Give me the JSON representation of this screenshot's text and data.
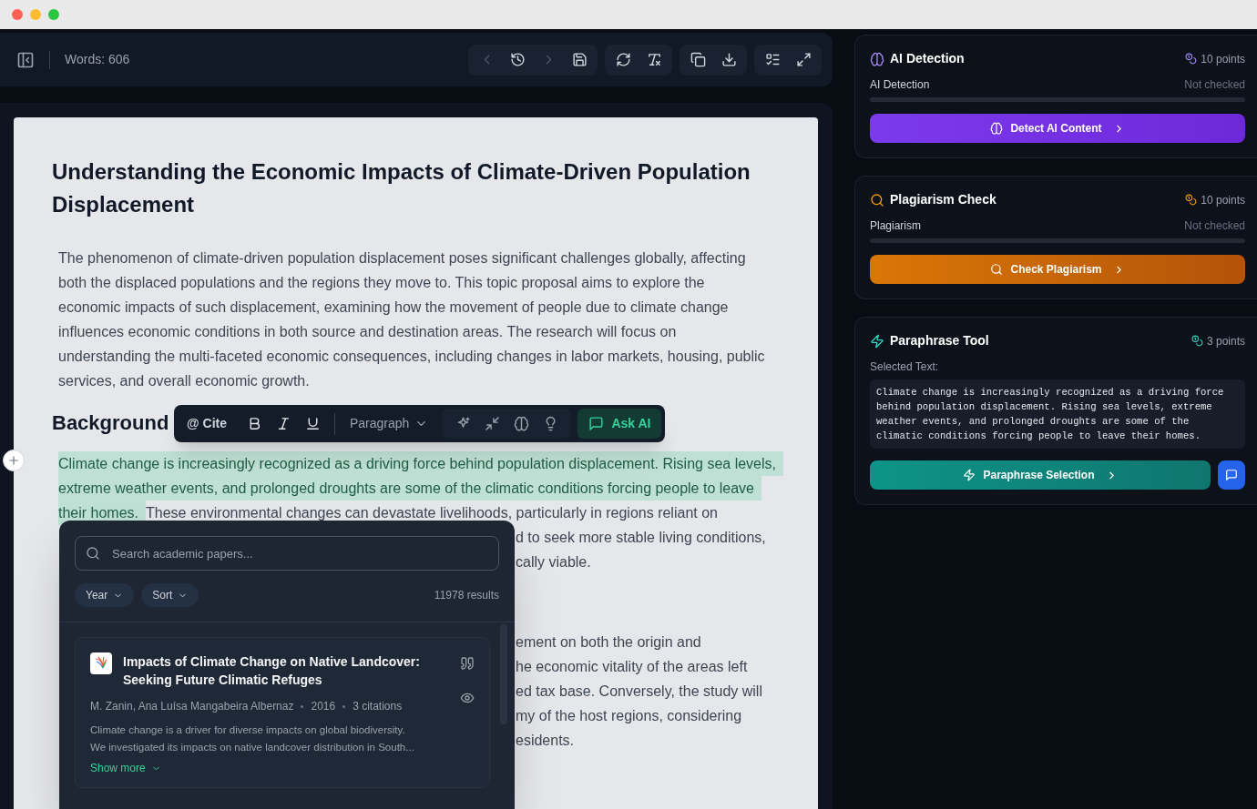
{
  "toolbar": {
    "word_count": "Words: 606",
    "groups": [
      [
        {
          "disabled": true
        },
        {
          "disabled": false
        },
        {
          "disabled": true
        },
        {
          "disabled": false
        }
      ],
      [
        {
          "disabled": false
        },
        {
          "disabled": false
        }
      ],
      [
        {
          "disabled": false
        },
        {
          "disabled": false
        }
      ],
      [
        {
          "disabled": false
        },
        {
          "disabled": false
        }
      ]
    ]
  },
  "document": {
    "title": "Understanding the Economic Impacts of Climate-Driven Population Displacement",
    "intro_lines": [
      "The phenomenon of climate-driven population displacement poses significant challenges globally, affecting",
      "both the displaced populations and the regions they move to. This topic proposal aims to explore the",
      "economic impacts of such displacement, examining how the movement of people due to climate change",
      "influences economic conditions in both source and destination areas. The research will focus on",
      "understanding the multi-faceted economic consequences, including changes in labor markets, housing, public",
      "services, and overall economic growth."
    ],
    "sections": [
      {
        "heading": "Background",
        "selected_lines": [
          "Climate change is increasingly recognized as a driving force behind population displacement. Rising sea levels,",
          "extreme weather events, and prolonged droughts are some of the climatic conditions forcing people to leave",
          "their homes."
        ],
        "rest": "These environmental changes can devastate livelihoods, particularly in regions reliant on",
        "fragments": [
          "d to seek more stable living conditions,",
          "cally viable."
        ]
      },
      {
        "fragments": [
          "ement on both the origin and",
          "he economic vitality of the areas left",
          "ed tax base. Conversely, the study will",
          "my of the host regions, considering",
          "esidents."
        ]
      }
    ]
  },
  "format_bar": {
    "cite": "@ Cite",
    "block_style": "Paragraph",
    "ask": "Ask AI"
  },
  "citation_popup": {
    "search_placeholder": "Search academic papers...",
    "filters": [
      "Year",
      "Sort"
    ],
    "result_count": "11978 results",
    "papers": [
      {
        "title": "Impacts of Climate Change on Native Landcover: Seeking Future Climatic Refuges",
        "authors": "M. Zanin, Ana Luísa Mangabeira Albernaz",
        "year": "2016",
        "citations": "3 citations",
        "abstract_lines": [
          "Climate change is a driver for diverse impacts on global biodiversity.",
          "We investigated its impacts on native landcover distribution in South..."
        ],
        "show_more": "Show more"
      }
    ]
  },
  "tools": [
    {
      "kind": "ai",
      "color": "#a78bfa",
      "title": "AI Detection",
      "points": "10 points",
      "label": "AI Detection",
      "status": "Not checked",
      "level": 0,
      "button": "Detect AI Content"
    },
    {
      "kind": "plagiarism",
      "color": "#f59e0b",
      "title": "Plagiarism Check",
      "points": "10 points",
      "label": "Plagiarism",
      "status": "Not checked",
      "level": 0,
      "button": "Check Plagiarism"
    },
    {
      "kind": "paraphrase",
      "color": "#2dd4bf",
      "title": "Paraphrase Tool",
      "points": "3 points",
      "label": "Selected Text:",
      "selected_text": "Climate change is increasingly recognized as a driving force behind population displacement. Rising sea levels, extreme weather events, and prolonged droughts are some of the climatic conditions forcing people to leave their homes.",
      "button": "Paraphrase Selection"
    }
  ]
}
